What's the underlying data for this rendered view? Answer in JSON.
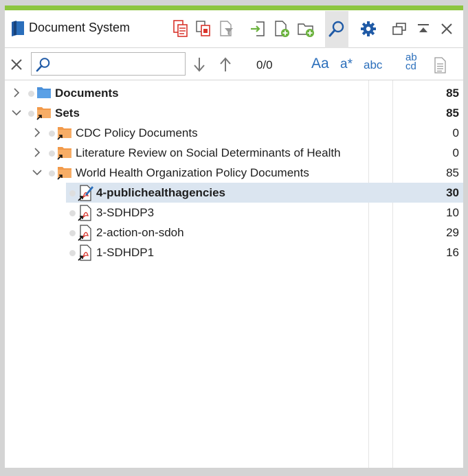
{
  "window": {
    "title": "Document System"
  },
  "search": {
    "value": "",
    "placeholder": "",
    "match_count": "0/0"
  },
  "search_options": {
    "match_case": "Aa",
    "regex": "a*",
    "whole_word": "abc",
    "replace": "ab\ncd"
  },
  "colors": {
    "accent": "#8dc63f",
    "icon_blue": "#2a6ebb",
    "folder_blue": "#4a90d9",
    "folder_orange": "#f7a35c",
    "selection": "#dbe5f0",
    "pdf_red": "#d9342b"
  },
  "tree": {
    "rows": [
      {
        "label": "Documents",
        "count": "85",
        "icon": "folder-blue-icon",
        "bold": true,
        "expanded": false
      },
      {
        "label": "Sets",
        "count": "85",
        "icon": "folder-set-icon",
        "bold": true,
        "expanded": true
      },
      {
        "label": "CDC Policy Documents",
        "count": "0",
        "icon": "folder-set-icon",
        "bold": false,
        "expanded": false
      },
      {
        "label": "Literature Review on Social Determinants of Health",
        "count": "0",
        "icon": "folder-set-icon",
        "bold": false,
        "expanded": false
      },
      {
        "label": "World Health Organization Policy Documents",
        "count": "85",
        "icon": "folder-set-icon",
        "bold": false,
        "expanded": true
      },
      {
        "label": "4-publichealthagencies",
        "count": "30",
        "icon": "pdf-edit-icon",
        "bold": true,
        "selected": true
      },
      {
        "label": "3-SDHDP3",
        "count": "10",
        "icon": "pdf-icon",
        "bold": false
      },
      {
        "label": "2-action-on-sdoh",
        "count": "29",
        "icon": "pdf-icon",
        "bold": false
      },
      {
        "label": "1-SDHDP1",
        "count": "16",
        "icon": "pdf-icon",
        "bold": false
      }
    ]
  }
}
